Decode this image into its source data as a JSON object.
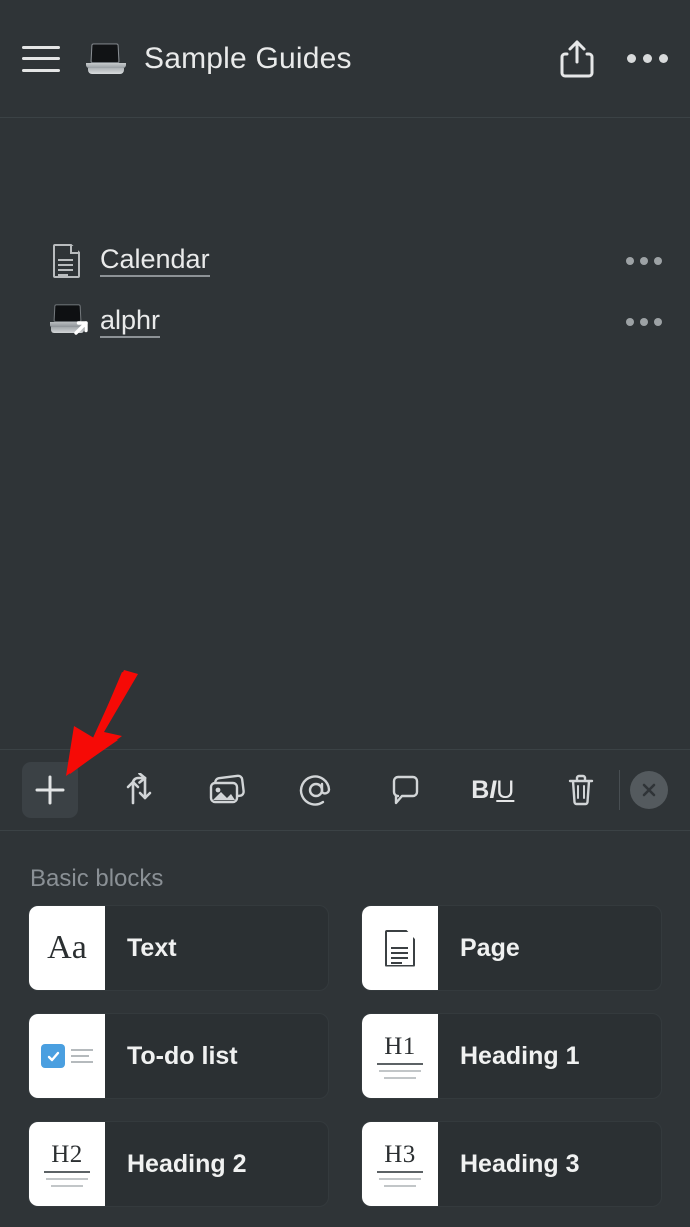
{
  "header": {
    "menu_icon": "hamburger-menu-icon",
    "page_emoji": "laptop-emoji",
    "title": "Sample Guides",
    "share_icon": "share-icon",
    "more_icon": "more-options-icon"
  },
  "content": {
    "rows": [
      {
        "icon": "document-icon",
        "label": "Calendar",
        "menu_icon": "more-options-icon"
      },
      {
        "icon": "laptop-link-icon",
        "label": "alphr",
        "menu_icon": "more-options-icon"
      }
    ]
  },
  "annotation": {
    "arrow_color": "#f60a06",
    "points_to": "add-block-button"
  },
  "toolbar": {
    "items": [
      {
        "name": "add-block-button",
        "icon": "plus-icon",
        "active": true
      },
      {
        "name": "move-block-button",
        "icon": "swap-arrows-icon",
        "active": false
      },
      {
        "name": "insert-image-button",
        "icon": "image-icon",
        "active": false
      },
      {
        "name": "mention-button",
        "icon": "at-sign-icon",
        "active": false
      },
      {
        "name": "comment-button",
        "icon": "comment-bubble-icon",
        "active": false
      },
      {
        "name": "format-text-button",
        "icon": "bold-italic-underline-icon",
        "active": false
      },
      {
        "name": "delete-block-button",
        "icon": "trash-icon",
        "active": false
      }
    ],
    "format_label": {
      "bold": "B",
      "italic": "I",
      "underline": "U"
    },
    "close_icon": "close-circle-icon"
  },
  "picker": {
    "section_title": "Basic blocks",
    "blocks": [
      {
        "label": "Text",
        "icon": "text-aa-icon",
        "icon_text": "Aa"
      },
      {
        "label": "Page",
        "icon": "page-icon",
        "icon_text": ""
      },
      {
        "label": "To-do list",
        "icon": "checkbox-icon",
        "icon_text": ""
      },
      {
        "label": "Heading 1",
        "icon": "heading-1-icon",
        "icon_text": "H1"
      },
      {
        "label": "Heading 2",
        "icon": "heading-2-icon",
        "icon_text": "H2"
      },
      {
        "label": "Heading 3",
        "icon": "heading-3-icon",
        "icon_text": "H3"
      }
    ]
  },
  "colors": {
    "background": "#2f3437",
    "card": "#2b3033",
    "text_primary": "#e9eaea",
    "text_muted": "#8a9095",
    "accent_blue": "#4a9fe0",
    "annotation_red": "#f60a06"
  }
}
